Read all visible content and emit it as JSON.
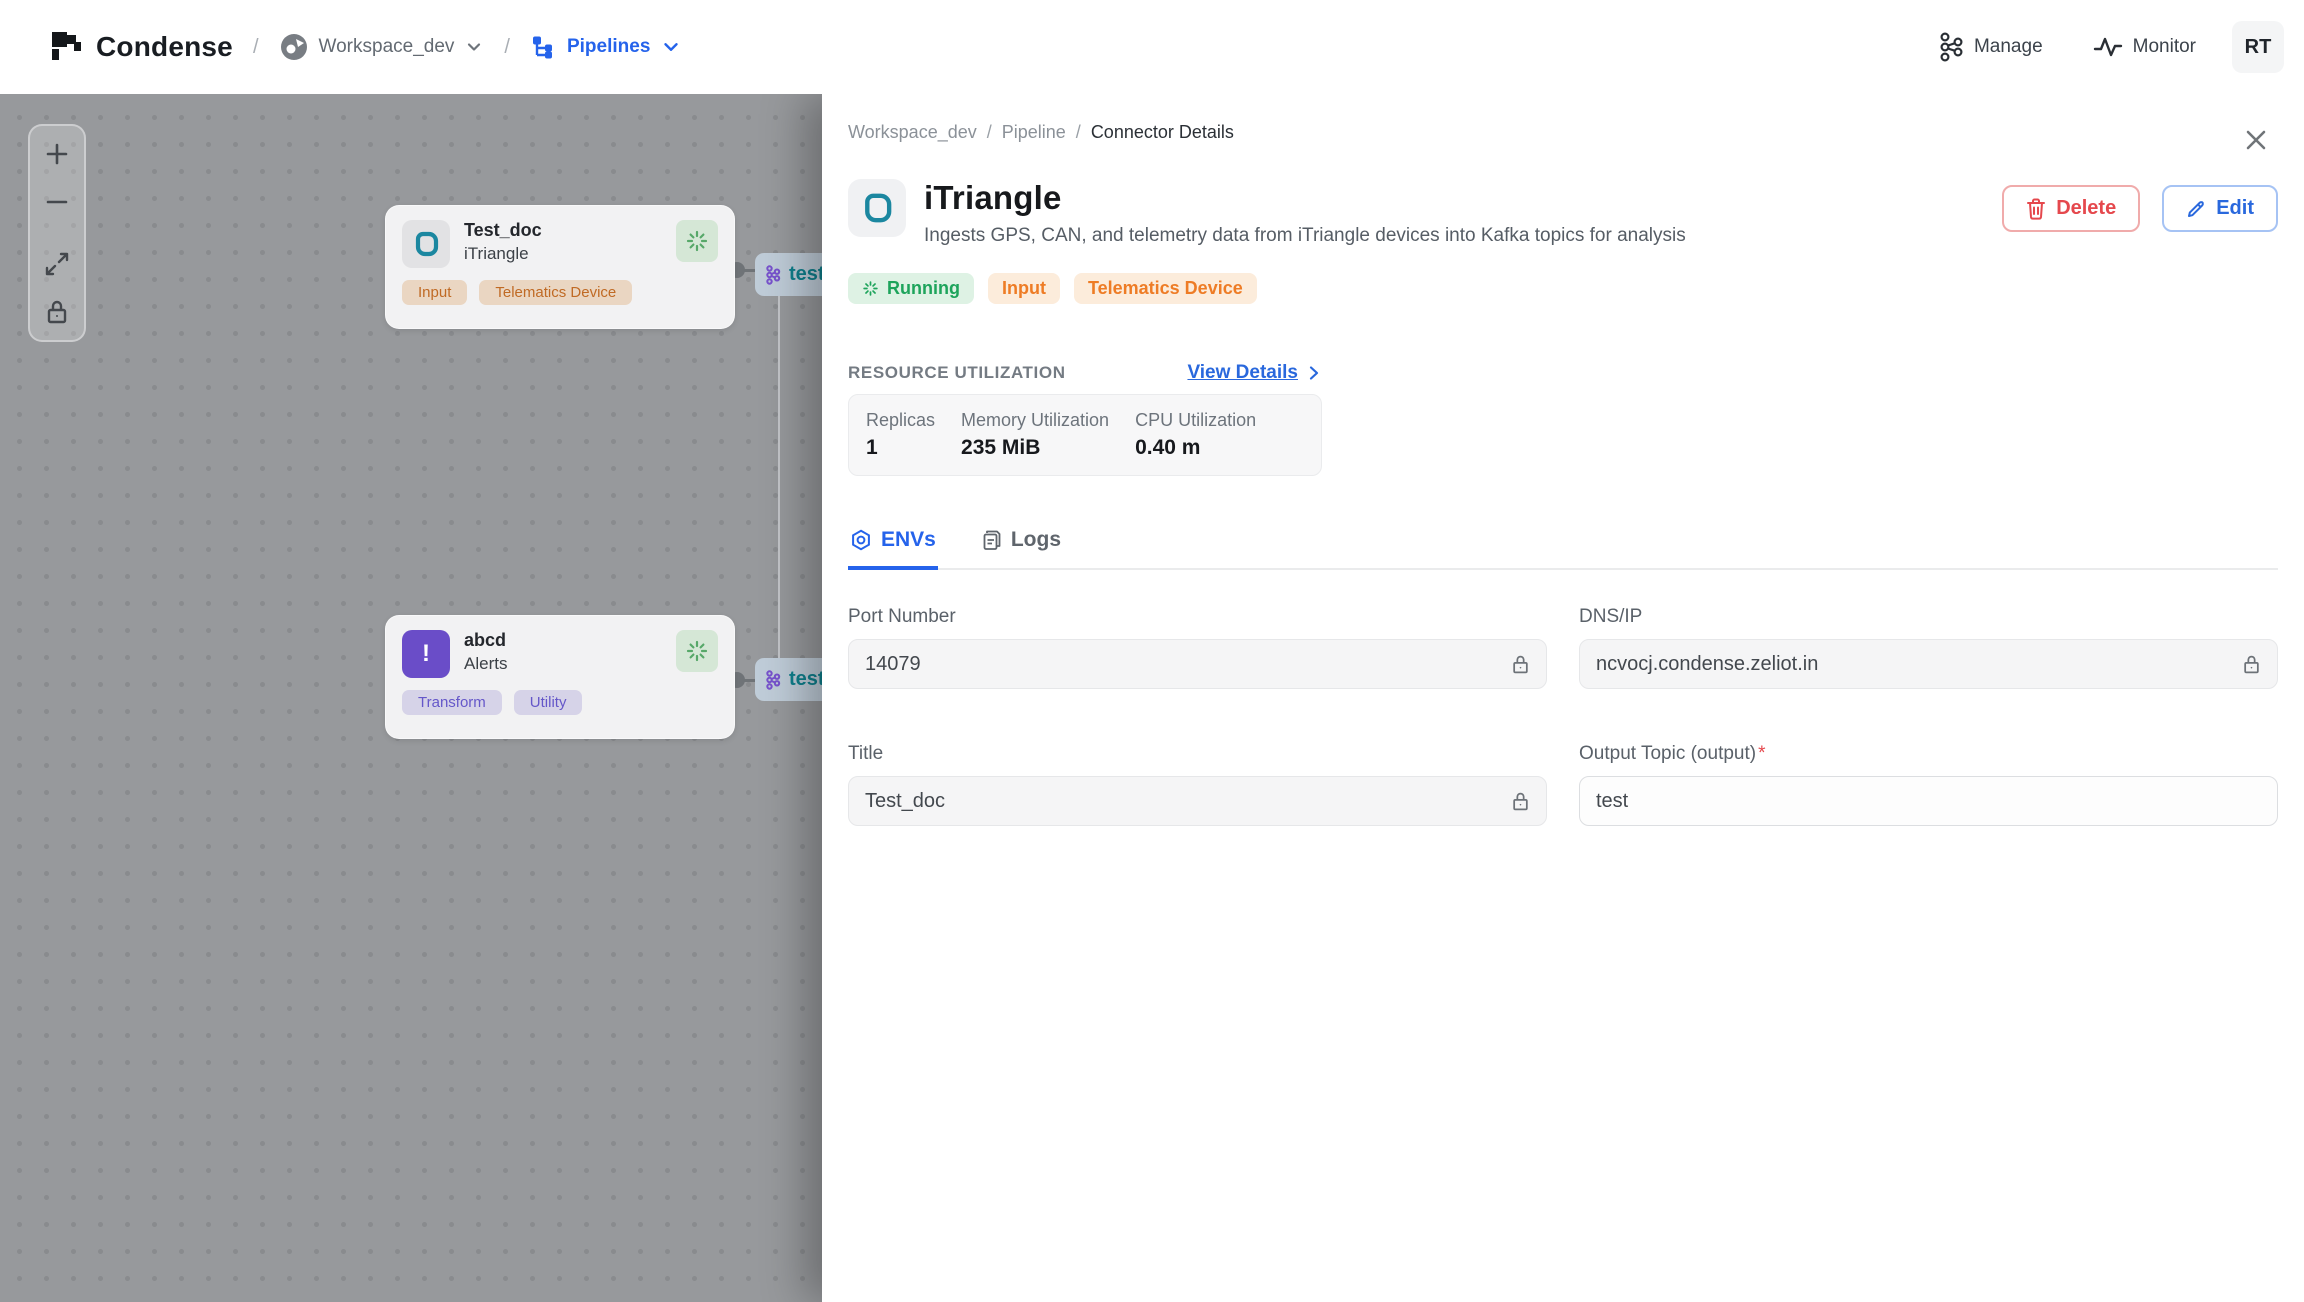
{
  "navbar": {
    "brand": "Condense",
    "sep": "/",
    "workspace": "Workspace_dev",
    "section": "Pipelines",
    "manage": "Manage",
    "monitor": "Monitor",
    "avatar": "RT"
  },
  "canvas": {
    "nodes": [
      {
        "title": "Test_doc",
        "subtitle": "iTriangle",
        "tags": [
          "Input",
          "Telematics Device"
        ]
      },
      {
        "title": "abcd",
        "subtitle": "Alerts",
        "alert_mark": "!",
        "tags": [
          "Transform",
          "Utility"
        ]
      }
    ],
    "topic_pill": "test"
  },
  "panel": {
    "breadcrumb": [
      "Workspace_dev",
      "Pipeline",
      "Connector Details"
    ],
    "title": "iTriangle",
    "description": "Ingests GPS, CAN, and telemetry data from iTriangle devices into Kafka topics for analysis",
    "actions": {
      "delete": "Delete",
      "edit": "Edit"
    },
    "badges": {
      "status": "Running",
      "type": "Input",
      "category": "Telematics Device"
    },
    "resource": {
      "heading": "RESOURCE UTILIZATION",
      "view_details": "View Details",
      "stats": [
        {
          "label": "Replicas",
          "value": "1"
        },
        {
          "label": "Memory Utilization",
          "value": "235 MiB"
        },
        {
          "label": "CPU Utilization",
          "value": "0.40 m"
        }
      ]
    },
    "tabs": [
      {
        "label": "ENVs"
      },
      {
        "label": "Logs"
      }
    ],
    "fields": [
      {
        "label": "Port Number",
        "value": "14079"
      },
      {
        "label": "DNS/IP",
        "value": "ncvocj.condense.zeliot.in"
      },
      {
        "label": "Title",
        "value": "Test_doc"
      },
      {
        "label": "Output Topic (output)",
        "required_mark": "*",
        "value": "test"
      }
    ]
  },
  "colors": {
    "accent_blue": "#2563eb",
    "danger_red": "#e5484d",
    "success_green": "#1da45b",
    "warn_orange": "#ee7c25",
    "teal_brand": "#1b87a0",
    "canvas_gray": "#97999c"
  }
}
